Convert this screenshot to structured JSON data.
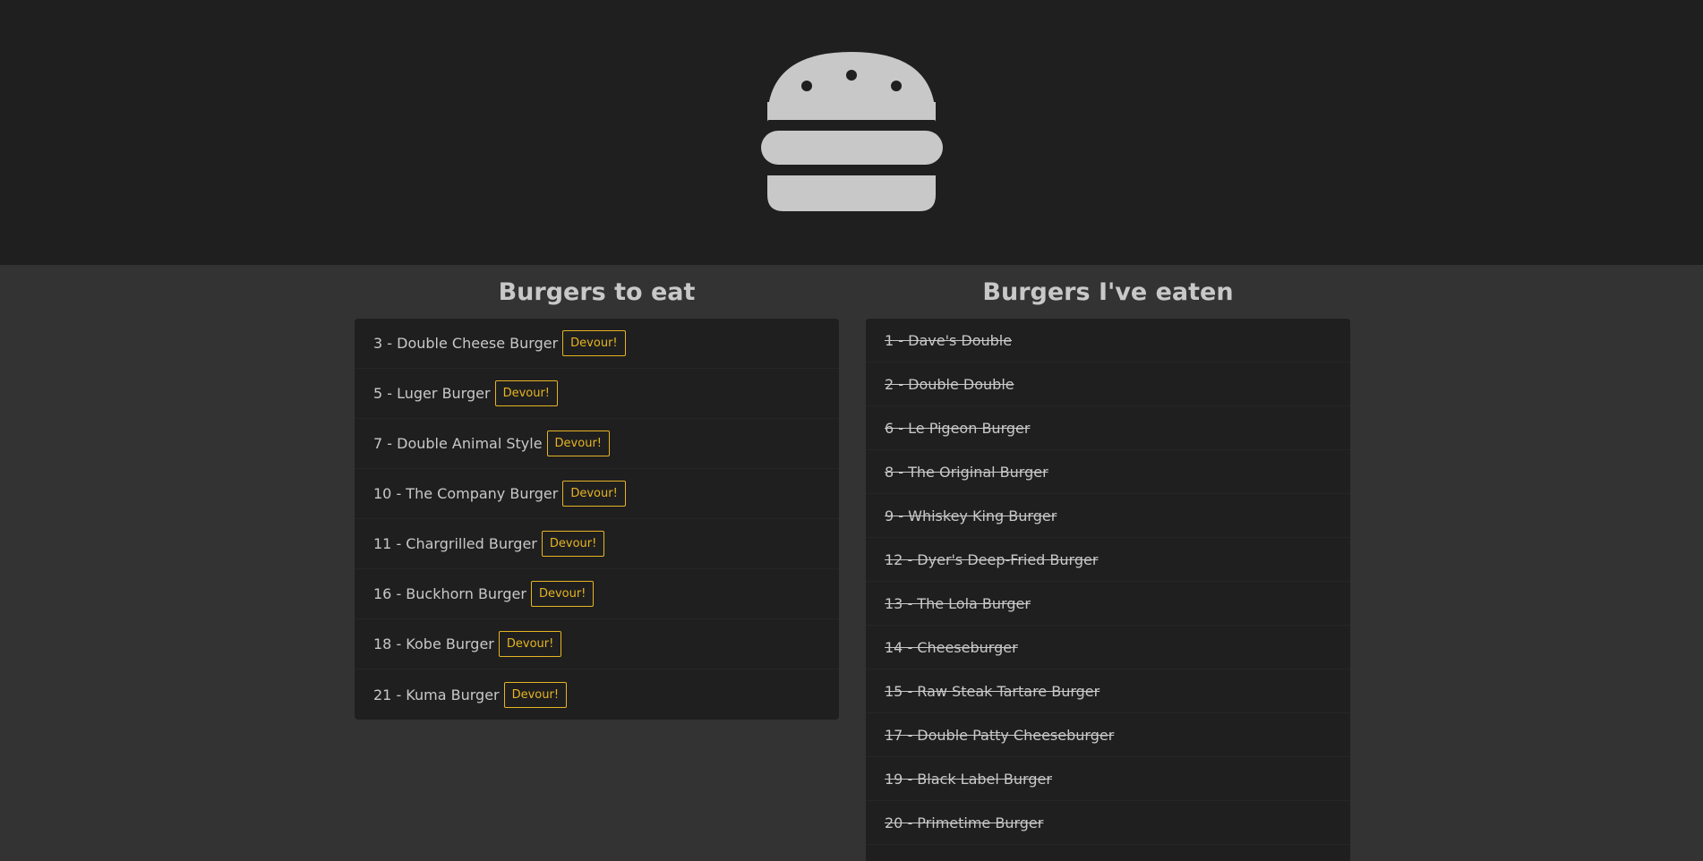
{
  "logo": {
    "icon": "burger-icon",
    "color": "#c8c8c8"
  },
  "to_eat": {
    "title": "Burgers to eat",
    "button_label": "Devour!",
    "items": [
      {
        "label": "3 - Double Cheese Burger"
      },
      {
        "label": "5 - Luger Burger"
      },
      {
        "label": "7 - Double Animal Style"
      },
      {
        "label": "10 - The Company Burger"
      },
      {
        "label": "11 - Chargrilled Burger"
      },
      {
        "label": "16 - Buckhorn Burger"
      },
      {
        "label": "18 - Kobe Burger"
      },
      {
        "label": "21 - Kuma Burger"
      }
    ]
  },
  "eaten": {
    "title": "Burgers I've eaten",
    "items": [
      {
        "label": "1 - Dave's Double"
      },
      {
        "label": "2 - Double Double"
      },
      {
        "label": "6 - Le Pigeon Burger"
      },
      {
        "label": "8 - The Original Burger"
      },
      {
        "label": "9 - Whiskey King Burger"
      },
      {
        "label": "12 - Dyer's Deep-Fried Burger"
      },
      {
        "label": "13 - The Lola Burger"
      },
      {
        "label": "14 - Cheeseburger"
      },
      {
        "label": "15 - Raw Steak Tartare Burger"
      },
      {
        "label": "17 - Double Patty Cheeseburger"
      },
      {
        "label": "19 - Black Label Burger"
      },
      {
        "label": "20 - Primetime Burger"
      }
    ]
  },
  "colors": {
    "header_bg": "#1f1f1f",
    "page_bg": "#333333",
    "accent": "#e6b422",
    "text": "#c8c8c8"
  }
}
